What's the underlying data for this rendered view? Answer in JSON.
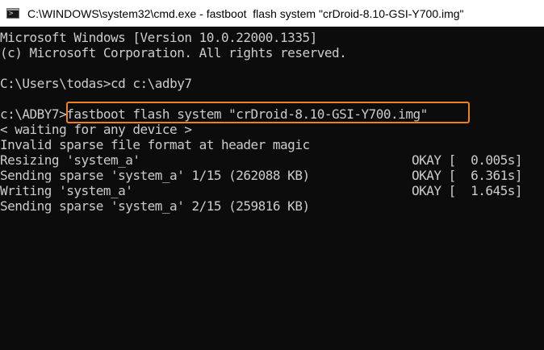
{
  "window": {
    "title": "C:\\WINDOWS\\system32\\cmd.exe - fastboot  flash system \"crDroid-8.10-GSI-Y700.img\"",
    "icon": "cmd-icon"
  },
  "console": {
    "header_line_1": "Microsoft Windows [Version 10.0.22000.1335]",
    "header_line_2": "(c) Microsoft Corporation. All rights reserved.",
    "cd_prompt": "C:\\Users\\todas>",
    "cd_command": "cd c:\\adby7",
    "flash_prompt": "c:\\ADBY7>",
    "flash_command": "fastboot flash system \"crDroid-8.10-GSI-Y700.img\"",
    "output": [
      {
        "message": "< waiting for any device >",
        "status": ""
      },
      {
        "message": "Invalid sparse file format at header magic",
        "status": ""
      },
      {
        "message": "Resizing 'system_a'",
        "status": "OKAY [  0.005s]"
      },
      {
        "message": "Sending sparse 'system_a' 1/15 (262088 KB)",
        "status": "OKAY [  6.361s]"
      },
      {
        "message": "Writing 'system_a'",
        "status": "OKAY [  1.645s]"
      },
      {
        "message": "Sending sparse 'system_a' 2/15 (259816 KB)",
        "status": ""
      }
    ]
  },
  "colors": {
    "background": "#0c0c0c",
    "text": "#cccccc",
    "titlebar": "#ffffff",
    "highlight": "#f07f1f"
  }
}
